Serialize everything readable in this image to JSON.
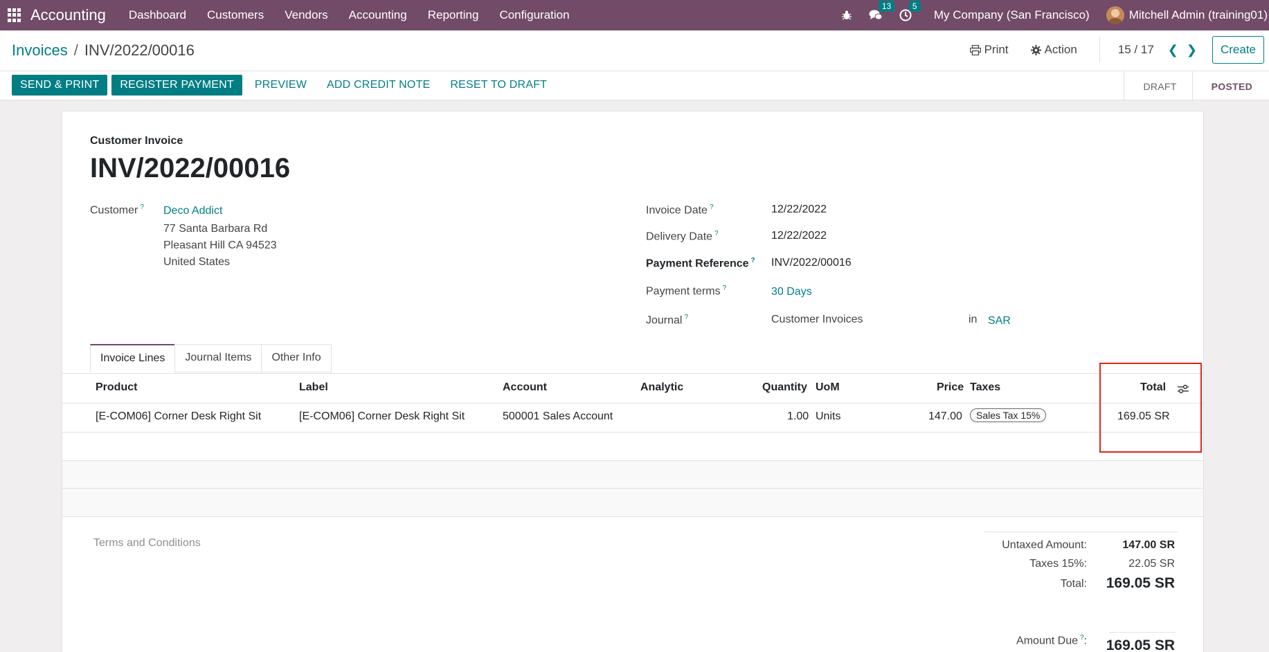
{
  "navbar": {
    "app_name": "Accounting",
    "menu": [
      "Dashboard",
      "Customers",
      "Vendors",
      "Accounting",
      "Reporting",
      "Configuration"
    ],
    "messages_count": "13",
    "activities_count": "5",
    "company": "My Company (San Francisco)",
    "user": "Mitchell Admin (training01)"
  },
  "control": {
    "breadcrumb_parent": "Invoices",
    "breadcrumb_current": "INV/2022/00016",
    "print_label": "Print",
    "action_label": "Action",
    "pager": "15 / 17",
    "create_label": "Create"
  },
  "statusbar": {
    "send_print": "SEND & PRINT",
    "register_payment": "REGISTER PAYMENT",
    "preview": "PREVIEW",
    "add_credit_note": "ADD CREDIT NOTE",
    "reset_to_draft": "RESET TO DRAFT",
    "stages": [
      "DRAFT",
      "POSTED"
    ]
  },
  "invoice": {
    "type": "Customer Invoice",
    "name": "INV/2022/00016",
    "customer_label": "Customer",
    "customer_name": "Deco Addict",
    "address_line1": "77 Santa Barbara Rd",
    "address_line2": "Pleasant Hill CA 94523",
    "address_line3": "United States",
    "invoice_date_label": "Invoice Date",
    "invoice_date": "12/22/2022",
    "delivery_date_label": "Delivery Date",
    "delivery_date": "12/22/2022",
    "payment_ref_label": "Payment Reference",
    "payment_ref": "INV/2022/00016",
    "payment_terms_label": "Payment terms",
    "payment_terms": "30 Days",
    "journal_label": "Journal",
    "journal": "Customer Invoices",
    "in_label": "in",
    "currency": "SAR"
  },
  "tabs": [
    "Invoice Lines",
    "Journal Items",
    "Other Info"
  ],
  "lines": {
    "headers": {
      "product": "Product",
      "label": "Label",
      "account": "Account",
      "analytic": "Analytic",
      "quantity": "Quantity",
      "uom": "UoM",
      "price": "Price",
      "taxes": "Taxes",
      "total": "Total"
    },
    "rows": [
      {
        "product": "[E-COM06] Corner Desk Right Sit",
        "label": "[E-COM06] Corner Desk Right Sit",
        "account": "500001 Sales Account",
        "analytic": "",
        "quantity": "1.00",
        "uom": "Units",
        "price": "147.00",
        "taxes": "Sales Tax 15%",
        "total": "169.05 SR"
      }
    ]
  },
  "footer": {
    "terms_placeholder": "Terms and Conditions",
    "untaxed_label": "Untaxed Amount:",
    "untaxed_value": "147.00 SR",
    "taxes_label": "Taxes 15%:",
    "taxes_value": "22.05 SR",
    "total_label": "Total:",
    "total_value": "169.05 SR",
    "amount_due_label": "Amount Due",
    "amount_due_value": "169.05 SR"
  },
  "colors": {
    "brand": "#714b67",
    "accent": "#017e84",
    "highlight": "#e2241a"
  }
}
